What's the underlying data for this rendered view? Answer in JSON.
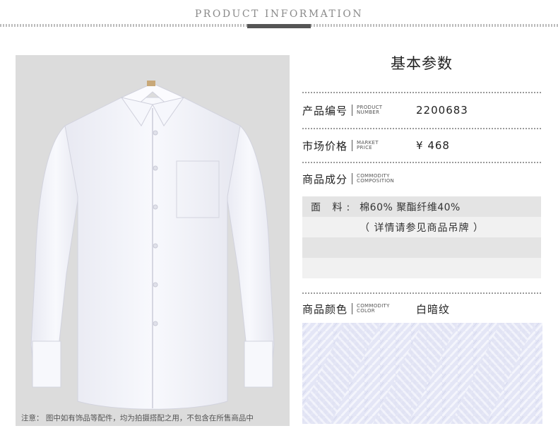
{
  "header": {
    "title": "PRODUCT INFORMATION"
  },
  "photo": {
    "note": "注意： 图中如有饰品等配件，均为拍摄搭配之用，不包含在所售商品中"
  },
  "info": {
    "section_title": "基本参数",
    "product_number": {
      "label": "产品编号",
      "en": [
        "PRODUCT",
        "NUMBER"
      ],
      "value": "2200683"
    },
    "market_price": {
      "label": "市场价格",
      "en": [
        "MARKET",
        "PRICE"
      ],
      "value": "¥ 468"
    },
    "composition": {
      "label": "商品成分",
      "en": [
        "COMMODITY",
        "COMPOSITION"
      ],
      "material_label": "面 料:",
      "material_value": "棉60%  聚酯纤维40%",
      "detail_note": "（ 详情请参见商品吊牌 ）"
    },
    "color": {
      "label": "商品颜色",
      "en": [
        "COMMODITY",
        "COLOR"
      ],
      "value": "白暗纹"
    }
  },
  "colors": {
    "photo_bg": "#dcdcdc",
    "shirt": "#f4f5fb",
    "fabric": "#e6e8f7",
    "band_dark": "#e4e4e4",
    "band_light": "#f1f1f1"
  }
}
